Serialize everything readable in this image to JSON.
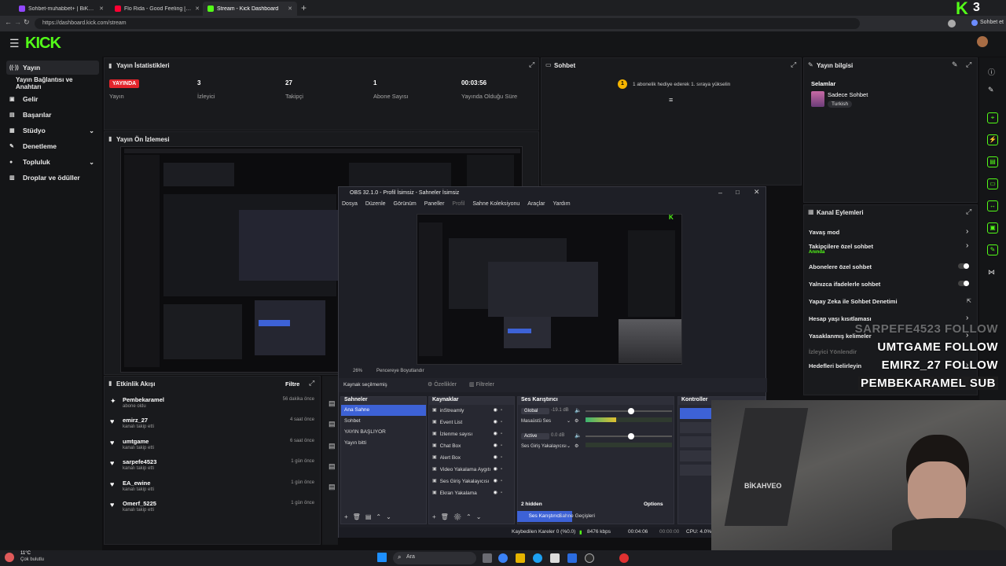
{
  "browser": {
    "tabs": [
      {
        "label": "Sohbet-muhabbet+ | BiKahve0/Tw...",
        "color": "#9147ff"
      },
      {
        "label": "Flo Rida - Good Feeling [Offi...",
        "color": "#ff0033"
      },
      {
        "label": "Stream - Kick Dashboard",
        "color": "#53fc18"
      }
    ],
    "url": "https://dashboard.kick.com/stream",
    "profile_label": "Sohbet et"
  },
  "kick": {
    "logo": "KICK",
    "corner_badge": "3"
  },
  "sidebar": {
    "items": [
      {
        "label": "Yayın",
        "icon": "broadcast-icon",
        "glyph": "((·))"
      },
      {
        "label": "Yayın Bağlantısı ve Anahtarı",
        "icon": "",
        "glyph": ""
      },
      {
        "label": "Gelir",
        "icon": "wallet-icon",
        "glyph": "▣"
      },
      {
        "label": "Başarılar",
        "icon": "trophy-icon",
        "glyph": "▤"
      },
      {
        "label": "Stüdyo",
        "icon": "studio-icon",
        "glyph": "▦"
      },
      {
        "label": "Denetleme",
        "icon": "hammer-icon",
        "glyph": "✎"
      },
      {
        "label": "Topluluk",
        "icon": "people-icon",
        "glyph": "●"
      },
      {
        "label": "Droplar ve ödüller",
        "icon": "gift-icon",
        "glyph": "▥"
      }
    ]
  },
  "stats": {
    "title": "Yayın İstatistikleri",
    "live_badge": "YAYINDA",
    "items": [
      {
        "value": "",
        "label": "Yayın"
      },
      {
        "value": "3",
        "label": "İzleyici"
      },
      {
        "value": "27",
        "label": "Takipçi"
      },
      {
        "value": "1",
        "label": "Abone Sayısı"
      },
      {
        "value": "00:03:56",
        "label": "Yayında Olduğu Süre"
      }
    ]
  },
  "preview": {
    "title": "Yayın Ön İzlemesi"
  },
  "chat": {
    "title": "Sohbet",
    "notice_count": "1",
    "notice": "1 abonelik hediye ederek 1. sıraya yükselin"
  },
  "stream_info": {
    "title": "Yayın bilgisi",
    "stream_title": "Selamlar",
    "category": "Sadece Sohbet",
    "language": "Turkish"
  },
  "channel_actions": {
    "title": "Kanal Eylemleri",
    "items": [
      {
        "label": "Yavaş mod",
        "sub": "",
        "control": "chevron"
      },
      {
        "label": "Takipçilere özel sohbet",
        "sub": "Anında",
        "control": "chevron"
      },
      {
        "label": "Abonelere özel sohbet",
        "sub": "",
        "control": "toggle"
      },
      {
        "label": "Yalnızca ifadelerle sohbet",
        "sub": "",
        "control": "toggle"
      },
      {
        "label": "Yapay Zeka ile Sohbet Denetimi",
        "sub": "",
        "control": "external"
      },
      {
        "label": "Hesap yaşı kısıtlaması",
        "sub": "",
        "control": "chevron"
      },
      {
        "label": "Yasaklanmış kelimeler",
        "sub": "",
        "control": "chevron"
      },
      {
        "label": "İzleyici Yönlendir",
        "sub": "",
        "control": "none"
      },
      {
        "label": "Hedefleri belirleyin",
        "sub": "",
        "control": "chevron"
      }
    ]
  },
  "overlay_alerts": [
    {
      "name": "SARPEFE4523",
      "action": "FOLLOW",
      "faded": true
    },
    {
      "name": "UMTGAME",
      "action": "FOLLOW",
      "faded": false
    },
    {
      "name": "EMIRZ_27",
      "action": "FOLLOW",
      "faded": false
    },
    {
      "name": "PEMBEKARAMEL",
      "action": "SUB",
      "faded": false
    }
  ],
  "activity": {
    "title": "Etkinlik Akışı",
    "filter": "Filtre",
    "events": [
      {
        "user": "Pembekaramel",
        "text": "abone oldu",
        "time": "56 dakika önce",
        "icon": "sparkle-icon",
        "glyph": "✦"
      },
      {
        "user": "emirz_27",
        "text": "kanalı takip etti",
        "time": "4 saat önce",
        "icon": "heart-icon",
        "glyph": "♥"
      },
      {
        "user": "umtgame",
        "text": "kanalı takip etti",
        "time": "6 saat önce",
        "icon": "heart-icon",
        "glyph": "♥"
      },
      {
        "user": "sarpefe4523",
        "text": "kanalı takip etti",
        "time": "1 gün önce",
        "icon": "heart-icon",
        "glyph": "♥"
      },
      {
        "user": "EA_ewine",
        "text": "kanalı takip etti",
        "time": "1 gün önce",
        "icon": "heart-icon",
        "glyph": "♥"
      },
      {
        "user": "Omerf_5225",
        "text": "kanalı takip etti",
        "time": "1 gün önce",
        "icon": "heart-icon",
        "glyph": "♥"
      }
    ]
  },
  "obs": {
    "title": "OBS 32.1.0 - Profil İsimsiz - Sahneler İsimsiz",
    "menu": [
      "Dosya",
      "Düzenle",
      "Görünüm",
      "Paneller",
      "Profil",
      "Sahne Koleksiyonu",
      "Araçlar",
      "Yardım"
    ],
    "zoom": "26%",
    "zoom_mode": "Pencereye Boyutlandır",
    "no_source": "Kaynak seçilmemiş",
    "properties": "Özellikler",
    "filters": "Filtreler",
    "scenes_title": "Sahneler",
    "scenes": [
      "Ana Sahne",
      "Sohbet",
      "YAYIN BAŞLIYOR",
      "Yayın bitti"
    ],
    "sources_title": "Kaynaklar",
    "sources": [
      "inStreamly",
      "Event List",
      "İzlenme sayısı",
      "Chat Box",
      "Alert Box",
      "Video Yakalama Aygıtı",
      "Ses Giriş Yakalayıcısı",
      "Ekran Yakalama"
    ],
    "mixer_title": "Ses Karıştırıcı",
    "mixer": [
      {
        "tag": "Global",
        "db": "-19.1 dB",
        "label": "Masaüstü Ses",
        "level": 0.35
      },
      {
        "tag": "Active",
        "db": "0.0 dB",
        "label": "Ses Giriş Yakalayıcısı",
        "level": 0.0
      }
    ],
    "hidden": "2 hidden",
    "options": "Options",
    "tab_mixer": "Ses Karıştırıcı",
    "tab_transitions": "Sahne Geçişleri",
    "controls_title": "Kontroller",
    "status": {
      "dropped": "Kaybedilen Kareler 0 (%0.0)",
      "bitrate": "8476 kbps",
      "time1": "00:04:06",
      "time2": "00:00:00",
      "cpu": "CPU: 4.0%"
    }
  },
  "taskbar": {
    "weather_temp": "11°C",
    "weather_text": "Çok bulutlu",
    "search": "Ara"
  },
  "webcam_text": "BİKAHVEO"
}
